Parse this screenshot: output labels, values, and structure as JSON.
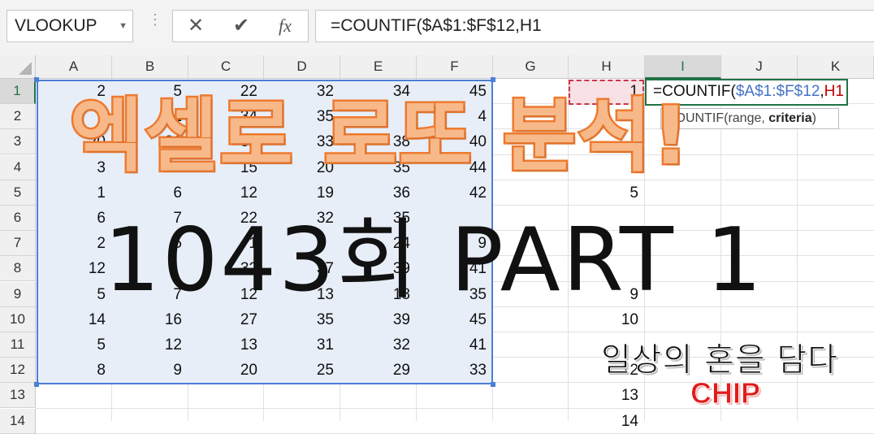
{
  "formula_bar": {
    "name_box": "VLOOKUP",
    "cancel_icon": "close-icon",
    "enter_icon": "check-icon",
    "fx_label": "fx",
    "formula": "=COUNTIF($A$1:$F$12,H1"
  },
  "columns": [
    "A",
    "B",
    "C",
    "D",
    "E",
    "F",
    "G",
    "H",
    "I",
    "J",
    "K"
  ],
  "rows": [
    "1",
    "2",
    "3",
    "4",
    "5",
    "6",
    "7",
    "8",
    "9",
    "10",
    "11",
    "12",
    "13",
    "14"
  ],
  "cells": {
    "r1": [
      "2",
      "5",
      "22",
      "32",
      "34",
      "45"
    ],
    "r2": [
      "9",
      "1",
      "34",
      "35",
      "",
      "4"
    ],
    "r3": [
      "20",
      "31",
      "32",
      "33",
      "38",
      "40"
    ],
    "r4": [
      "3",
      "11",
      "15",
      "20",
      "35",
      "44"
    ],
    "r5": [
      "1",
      "6",
      "12",
      "19",
      "36",
      "42"
    ],
    "r6": [
      "6",
      "7",
      "22",
      "32",
      "35",
      ""
    ],
    "r7": [
      "2",
      "5",
      "1",
      "",
      "24",
      "9"
    ],
    "r8": [
      "12",
      "",
      "32",
      "37",
      "39",
      "41"
    ],
    "r9": [
      "5",
      "7",
      "12",
      "13",
      "18",
      "35"
    ],
    "r10": [
      "14",
      "16",
      "27",
      "35",
      "39",
      "45"
    ],
    "r11": [
      "5",
      "12",
      "13",
      "31",
      "32",
      "41"
    ],
    "r12": [
      "8",
      "9",
      "20",
      "25",
      "29",
      "33"
    ]
  },
  "col_h": {
    "1": "1",
    "5": "5",
    "9": "9",
    "10": "10",
    "12": "12",
    "13": "13",
    "14": "14"
  },
  "edit_cell": {
    "prefix": "=COUNTIF(",
    "ref": "$A$1:$F$12",
    "sep": ",",
    "arg": "H1"
  },
  "tooltip": {
    "fn": "COUNTIF",
    "args_start": "(range, ",
    "arg": "criteria",
    "end": ")"
  },
  "overlay": {
    "title": "엑셀로 로또 분석!",
    "subtitle": "1043회 PART 1",
    "tagline": "일상의 혼을 담다",
    "brand": "CHIP"
  },
  "colors": {
    "excel_green": "#217346",
    "range_blue": "#4c7fd6",
    "title_orange": "#ee7a2f",
    "brand_red": "#e31c1c"
  }
}
